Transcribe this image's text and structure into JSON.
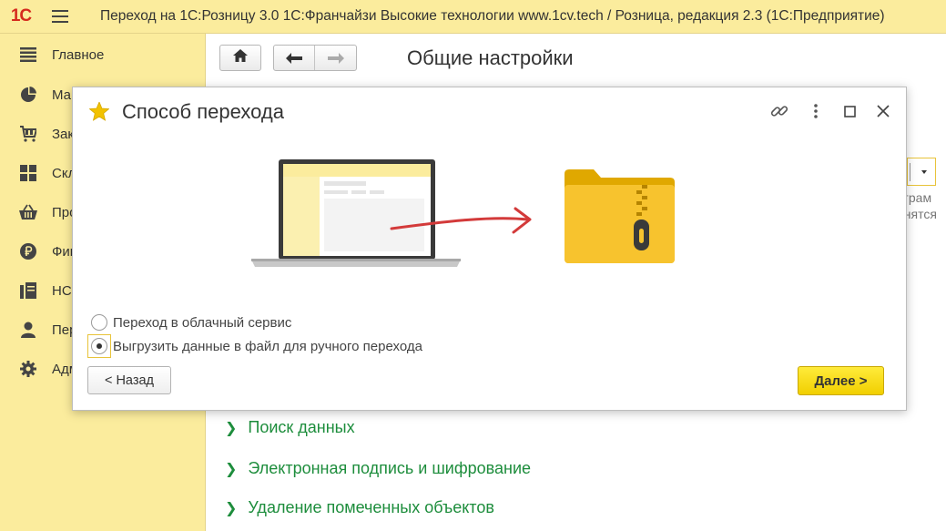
{
  "window": {
    "logo": "1С",
    "title": "Переход на 1С:Розницу 3.0  1С:Франчайзи Высокие технологии  www.1cv.tech / Розница, редакция 2.3  (1С:Предприятие)"
  },
  "sidebar": {
    "items": [
      {
        "label": "Главное",
        "icon": "menu-lines-icon"
      },
      {
        "label": "Ма",
        "icon": "pie-chart-icon"
      },
      {
        "label": "Зак",
        "icon": "cart-icon"
      },
      {
        "label": "Скл",
        "icon": "warehouse-grid-icon"
      },
      {
        "label": "Про",
        "icon": "basket-icon"
      },
      {
        "label": "Фин",
        "icon": "ruble-icon"
      },
      {
        "label": "НС",
        "icon": "documents-icon"
      },
      {
        "label": "Пер",
        "icon": "person-icon"
      },
      {
        "label": "Адм",
        "icon": "gear-icon"
      }
    ]
  },
  "main": {
    "page_title": "Общие настройки",
    "right_text_1": "ограм",
    "right_text_2": "анятся",
    "sections": [
      "Поиск данных",
      "Электронная подпись и шифрование",
      "Удаление помеченных объектов"
    ]
  },
  "dialog": {
    "title": "Способ перехода",
    "options": [
      {
        "label": "Переход в облачный сервис",
        "checked": false
      },
      {
        "label": "Выгрузить данные в файл для ручного перехода",
        "checked": true
      }
    ],
    "back_label": "< Назад",
    "next_label": "Далее >"
  },
  "colors": {
    "sidebar_bg": "#fbec9d",
    "accent_green": "#1d8d3c",
    "button_yellow": "#f7dc1a",
    "logo_red": "#d52b1e"
  }
}
